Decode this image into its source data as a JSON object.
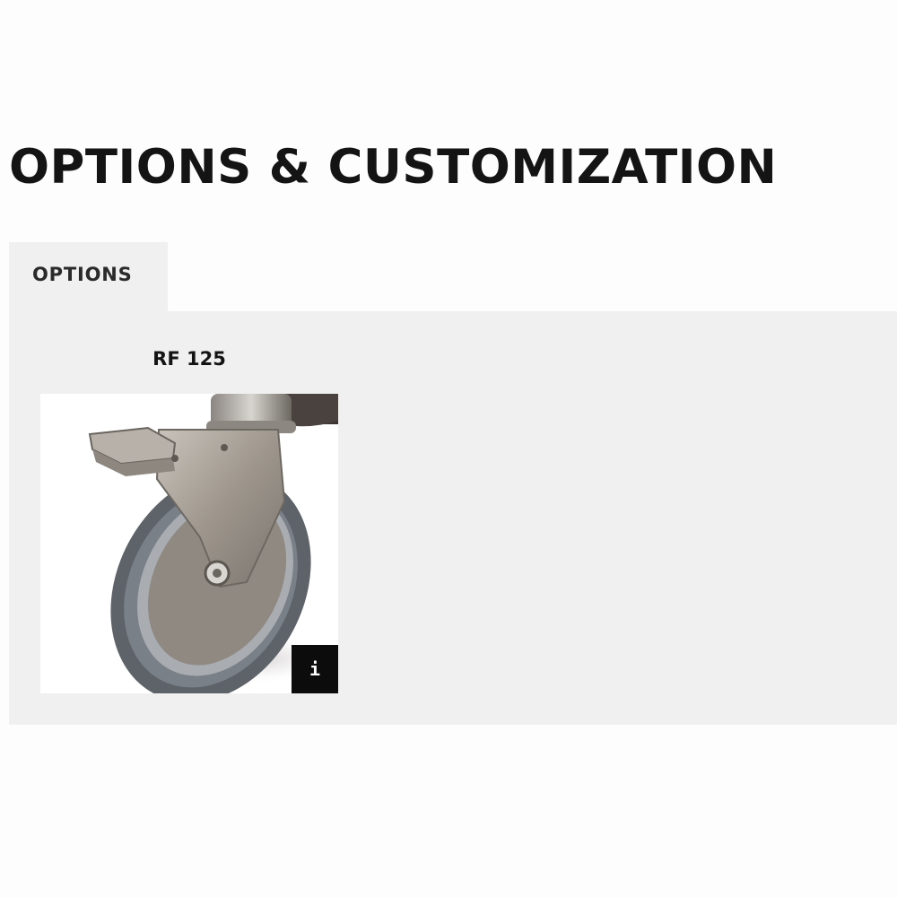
{
  "section": {
    "title": "OPTIONS & CUSTOMIZATION"
  },
  "tabs": [
    {
      "label": "OPTIONS",
      "active": true
    }
  ],
  "options": [
    {
      "name": "RF 125",
      "image_icon": "caster-wheel-image",
      "info_button": {
        "icon": "info-icon",
        "glyph": "i"
      }
    }
  ],
  "colors": {
    "panel_background": "#f0f0f0",
    "info_button_background": "#0c0c0c",
    "title_text": "#141414"
  }
}
